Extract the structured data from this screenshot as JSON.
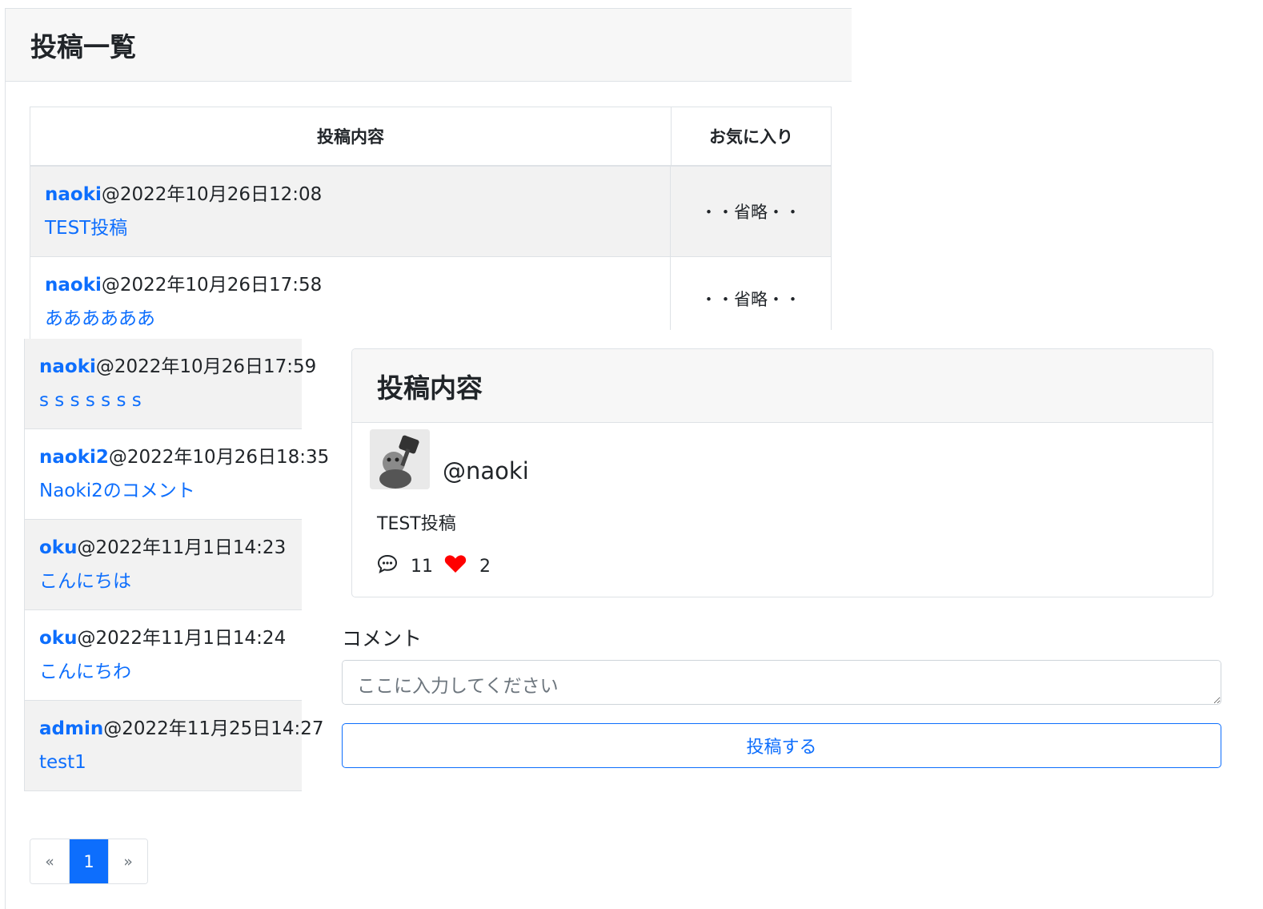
{
  "list": {
    "title": "投稿一覧",
    "headers": {
      "content": "投稿内容",
      "favorite": "お気に入り"
    },
    "rows": [
      {
        "user": "naoki",
        "datetime": "@2022年10月26日12:08",
        "body": "TEST投稿",
        "favorite": "・・省略・・"
      },
      {
        "user": "naoki",
        "datetime": "@2022年10月26日17:58",
        "body": "ああああああ",
        "favorite": "・・省略・・"
      },
      {
        "user": "naoki",
        "datetime": "@2022年10月26日17:59",
        "body": "s s s s s s s"
      },
      {
        "user": "naoki2",
        "datetime": "@2022年10月26日18:35",
        "body": "Naoki2のコメント"
      },
      {
        "user": "oku",
        "datetime": "@2022年11月1日14:23",
        "body": "こんにちは"
      },
      {
        "user": "oku",
        "datetime": "@2022年11月1日14:24",
        "body": "こんにちわ"
      },
      {
        "user": "admin",
        "datetime": "@2022年11月25日14:27",
        "body": "test1"
      }
    ],
    "pagination": {
      "prev": "«",
      "current": "1",
      "next": "»"
    }
  },
  "detail": {
    "title": "投稿内容",
    "handle": "@naoki",
    "body": "TEST投稿",
    "comment_count": "11",
    "like_count": "2",
    "colors": {
      "heart": "#ff0000",
      "accent": "#0d6efd"
    }
  },
  "comment_form": {
    "label": "コメント",
    "placeholder": "ここに入力してください",
    "submit_label": "投稿する"
  }
}
